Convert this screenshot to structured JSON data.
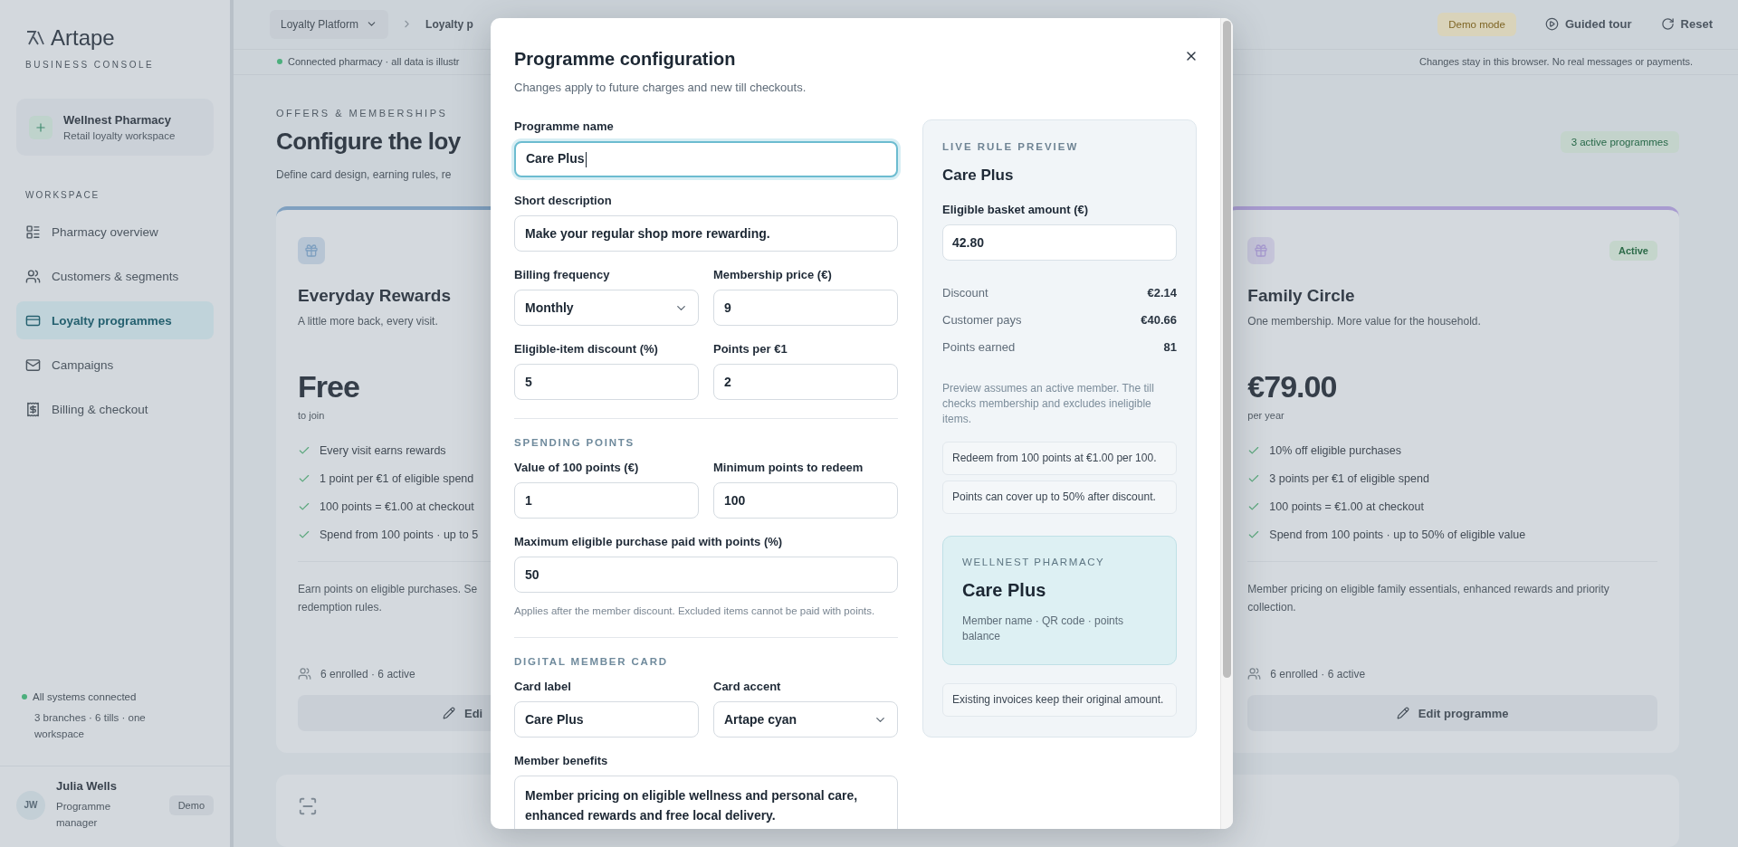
{
  "sidebar": {
    "logo": "Artape",
    "subtitle": "BUSINESS CONSOLE",
    "workspace": {
      "name": "Wellnest Pharmacy",
      "description": "Retail loyalty workspace"
    },
    "section_label": "WORKSPACE",
    "items": [
      {
        "label": "Pharmacy overview",
        "selected": false
      },
      {
        "label": "Customers & segments",
        "selected": false
      },
      {
        "label": "Loyalty programmes",
        "selected": true
      },
      {
        "label": "Campaigns",
        "selected": false
      },
      {
        "label": "Billing & checkout",
        "selected": false
      }
    ],
    "status": {
      "title": "All systems connected",
      "detail": "3 branches · 6 tills · one workspace"
    },
    "user": {
      "initials": "JW",
      "name": "Julia Wells",
      "role": "Programme manager",
      "badge": "Demo"
    }
  },
  "topbar": {
    "breadcrumb": [
      "Loyalty Platform",
      "Loyalty p"
    ],
    "demo_badge": "Demo mode",
    "actions": [
      "Guided tour",
      "Reset"
    ]
  },
  "notice_bar": {
    "left": "Connected pharmacy · all data is illustr",
    "right": "Changes stay in this browser. No real messages or payments."
  },
  "page": {
    "eyebrow": "OFFERS & MEMBERSHIPS",
    "title": "Configure the loy",
    "description": "Define card design, earning rules, re",
    "badge": "3 active programmes"
  },
  "cards": [
    {
      "color": "#7fa0c0",
      "title": "Everyday Rewards",
      "subtitle": "A little more back, every visit.",
      "price": "Free",
      "price_note": "to join",
      "features": [
        "Every visit earns rewards",
        "1 point per €1 of eligible spend",
        "100 points = €1.00 at checkout",
        "Spend from 100 points · up to 5"
      ],
      "summary": "Earn points on eligible purchases. Se redemption rules.",
      "enrolment": "6 enrolled · 6 active",
      "button": "Edi"
    },
    {
      "color": "#a89bd0",
      "badge": "Active",
      "title": "Family Circle",
      "subtitle": "One membership. More value for the household.",
      "price": "€79.00",
      "price_note": "per year",
      "features": [
        "10% off eligible purchases",
        "3 points per €1 of eligible spend",
        "100 points = €1.00 at checkout",
        "Spend from 100 points · up to 50% of eligible value"
      ],
      "summary": "Member pricing on eligible family essentials, enhanced rewards and priority collection.",
      "enrolment": "6 enrolled · 6 active",
      "button": "Edit programme"
    }
  ],
  "modal": {
    "title": "Programme configuration",
    "subtitle": "Changes apply to future charges and new till checkouts.",
    "sections": [
      {
        "rows": [
          [
            {
              "kind": "text",
              "label": "Programme name",
              "value": "Care Plus",
              "focused": true
            }
          ],
          [
            {
              "kind": "text",
              "label": "Short description",
              "value": "Make your regular shop more rewarding.",
              "focused": false
            }
          ],
          [
            {
              "kind": "select",
              "label": "Billing frequency",
              "value": "Monthly",
              "focused": false
            },
            {
              "kind": "text",
              "label": "Membership price (€)",
              "value": "9",
              "focused": false
            }
          ],
          [
            {
              "kind": "text",
              "label": "Eligible-item discount (%)",
              "value": "5",
              "focused": false
            },
            {
              "kind": "text",
              "label": "Points per €1",
              "value": "2",
              "focused": false
            }
          ]
        ]
      },
      {
        "heading": "SPENDING POINTS",
        "rows": [
          [
            {
              "kind": "text",
              "label": "Value of 100 points (€)",
              "value": "1",
              "focused": false
            },
            {
              "kind": "text",
              "label": "Minimum points to redeem",
              "value": "100",
              "focused": false
            }
          ],
          [
            {
              "kind": "text",
              "label": "Maximum eligible purchase paid with points (%)",
              "value": "50",
              "focused": false
            }
          ]
        ],
        "hint": "Applies after the member discount. Excluded items cannot be paid with points."
      },
      {
        "heading": "DIGITAL MEMBER CARD",
        "rows": [
          [
            {
              "kind": "text",
              "label": "Card label",
              "value": "Care Plus",
              "focused": false
            },
            {
              "kind": "select",
              "label": "Card accent",
              "value": "Artape cyan",
              "focused": false
            }
          ],
          [
            {
              "kind": "textarea",
              "label": "Member benefits",
              "value": "Member pricing on eligible wellness and personal care, enhanced rewards and free local delivery.",
              "focused": false
            }
          ]
        ]
      }
    ],
    "preview": {
      "heading": "LIVE RULE PREVIEW",
      "title": "Care Plus",
      "basket_label": "Eligible basket amount (€)",
      "basket_value": "42.80",
      "rows": [
        {
          "label": "Discount",
          "value": "€2.14"
        },
        {
          "label": "Customer pays",
          "value": "€40.66"
        },
        {
          "label": "Points earned",
          "value": "81"
        }
      ],
      "note": "Preview assumes an active member. The till checks membership and excludes ineligible items.",
      "rules": [
        "Redeem from 100 points at €1.00 per 100.",
        "Points can cover up to 50% after discount."
      ],
      "card": {
        "eyebrow": "WELLNEST PHARMACY",
        "title": "Care Plus",
        "detail": "Member name · QR code · points balance"
      },
      "footnote": "Existing invoices keep their original amount."
    }
  }
}
